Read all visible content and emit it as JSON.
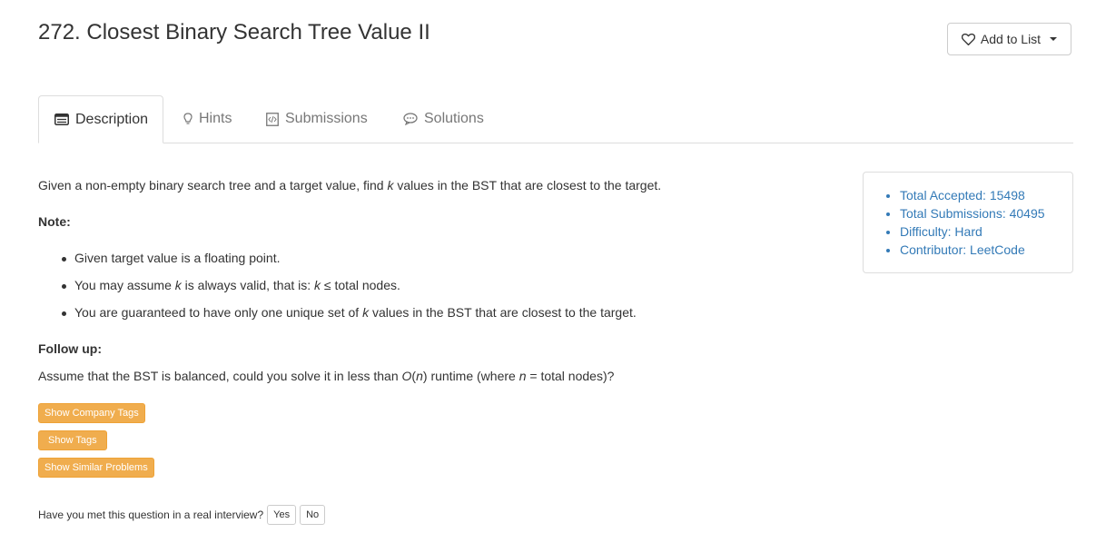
{
  "problem": {
    "title": "272. Closest Binary Search Tree Value II",
    "add_to_list": "Add to List"
  },
  "tabs": [
    {
      "label": "Description",
      "icon": "description-icon"
    },
    {
      "label": "Hints",
      "icon": "lightbulb-icon"
    },
    {
      "label": "Submissions",
      "icon": "code-file-icon"
    },
    {
      "label": "Solutions",
      "icon": "chat-bubble-icon"
    }
  ],
  "description": {
    "intro_pre": "Given a non-empty binary search tree and a target value, find ",
    "intro_k": "k",
    "intro_post": " values in the BST that are closest to the target.",
    "note_label": "Note:",
    "note_1": "Given target value is a floating point.",
    "note_2_pre": "You may assume ",
    "note_2_k": "k",
    "note_2_mid": " is always valid, that is: ",
    "note_2_k2": "k",
    "note_2_post": " ≤ total nodes.",
    "note_3_pre": "You are guaranteed to have only one unique set of ",
    "note_3_k": "k",
    "note_3_post": " values in the BST that are closest to the target.",
    "followup_label": "Follow up:",
    "followup_pre": "Assume that the BST is balanced, could you solve it in less than ",
    "followup_o": "O",
    "followup_paren_open": "(",
    "followup_n": "n",
    "followup_mid": ") runtime (where ",
    "followup_n2": "n",
    "followup_post": " = total nodes)?"
  },
  "buttons": {
    "company_tags": "Show Company Tags",
    "tags": "Show Tags",
    "similar": "Show Similar Problems"
  },
  "interview": {
    "question": "Have you met this question in a real interview?",
    "yes": "Yes",
    "no": "No"
  },
  "stats": {
    "accepted": "Total Accepted: 15498",
    "submissions": "Total Submissions: 40495",
    "difficulty": "Difficulty: Hard",
    "contributor": "Contributor: LeetCode"
  },
  "colors": {
    "link_blue": "#337ab7",
    "warning_orange": "#f0ad4e"
  }
}
